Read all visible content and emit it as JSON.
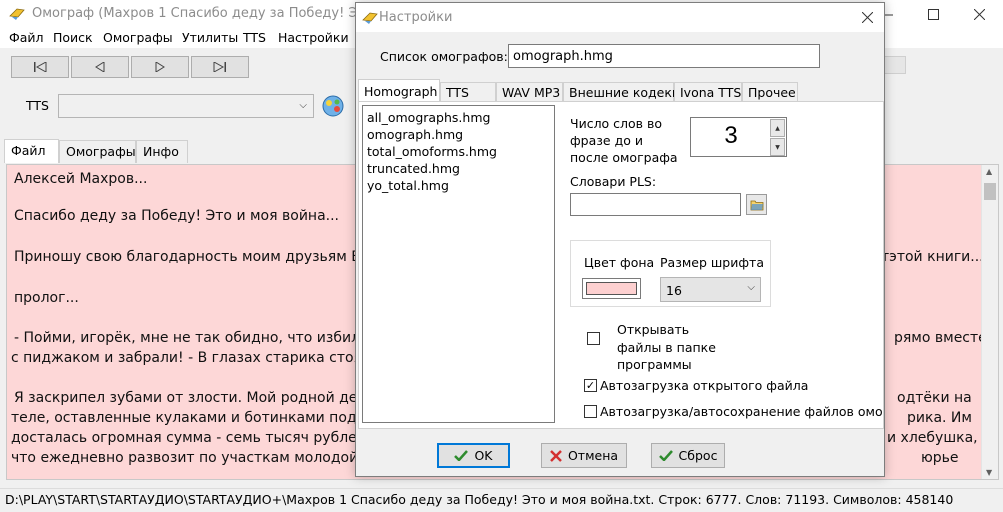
{
  "main_window": {
    "title": "Омограф (Махров 1 Спасибо деду за Победу! Это и м",
    "menu": [
      "Файл",
      "Поиск",
      "Омографы",
      "Утилиты",
      "TTS",
      "Настройки"
    ],
    "tts_label": "TTS",
    "tts_selected": "",
    "tabs": [
      "Файл",
      "Омографы",
      "Инфо"
    ],
    "text_lines": [
      "Алексей Махров...",
      "Спасибо деду за Победу! Это и моя война...",
      "Приношу свою благодарность моим друзьям Бо",
      "тэтой книги...",
      "пролог...",
      "- Пойми, игорёк, мне не так обидно, что избили,",
      "рямо вместе",
      "с пиджаком и забрали! - В глазах старика стояли",
      "Я заскрипел зубами от злости. Мой родной дед -",
      "одтёки на",
      "теле, оставленные кулаками и ботинками подонк",
      "рика. Им",
      "досталась огромная сумма - семь тысяч рублей,",
      "и хлебушка,",
      "что ежедневно развозит по участкам молодой пр",
      "юрье"
    ],
    "status": "D:\\PLAY\\START\\STARTАУДИО\\STARTАУДИО+\\Махров 1 Спасибо деду за Победу! Это и моя война.txt. Строк: 6777. Слов: 71193. Символов: 458140"
  },
  "settings": {
    "title": "Настройки",
    "list_label": "Список омографов:",
    "list_value": "omograph.hmg",
    "tabs": [
      "Homograph",
      "TTS",
      "WAV MP3",
      "Внешние кодеки",
      "Ivona TTS",
      "Прочее"
    ],
    "files": [
      "all_omographs.hmg",
      "omograph.hmg",
      "total_omoforms.hmg",
      "truncated.hmg",
      "yo_total.hmg"
    ],
    "words_label": [
      "Число слов во",
      "фразе до и",
      "после омографа"
    ],
    "words_value": "3",
    "pls_label": "Словари PLS:",
    "pls_value": "",
    "bg_color_label": "Цвет фона",
    "font_size_label": "Размер шрифта",
    "font_size_value": "16",
    "bg_color": "#fdd0d0",
    "open_in_folder_label": [
      "Открывать",
      "файлы в папке",
      "программы"
    ],
    "autoload_label": "Автозагрузка открытого файла",
    "autosave_label": "Автозагрузка/автосохранение файлов омо",
    "buttons": {
      "ok": "OK",
      "cancel": "Отмена",
      "reset": "Сброс"
    }
  }
}
